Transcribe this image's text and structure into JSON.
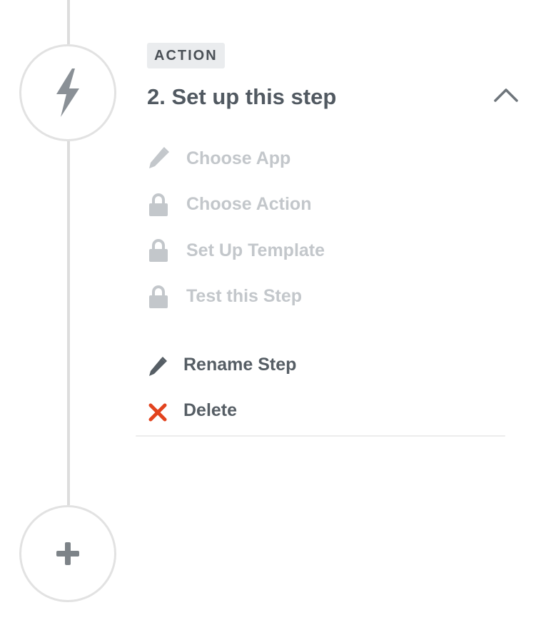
{
  "step": {
    "badge": "ACTION",
    "title": "2. Set up this step",
    "icon": "lightning-bolt-icon"
  },
  "substeps": [
    {
      "label": "Choose App",
      "icon": "pencil-icon",
      "state": "editable"
    },
    {
      "label": "Choose Action",
      "icon": "lock-icon",
      "state": "locked"
    },
    {
      "label": "Set Up Template",
      "icon": "lock-icon",
      "state": "locked"
    },
    {
      "label": "Test this Step",
      "icon": "lock-icon",
      "state": "locked"
    }
  ],
  "options": {
    "rename": {
      "label": "Rename Step",
      "icon": "pencil-icon"
    },
    "delete": {
      "label": "Delete",
      "icon": "x-icon"
    }
  },
  "add_step": {
    "icon": "plus-icon"
  },
  "colors": {
    "muted": "#c3c7cb",
    "text": "#565e65",
    "danger": "#e2431e",
    "circle_border": "#e2e2e2",
    "icon": "#8a9096"
  }
}
